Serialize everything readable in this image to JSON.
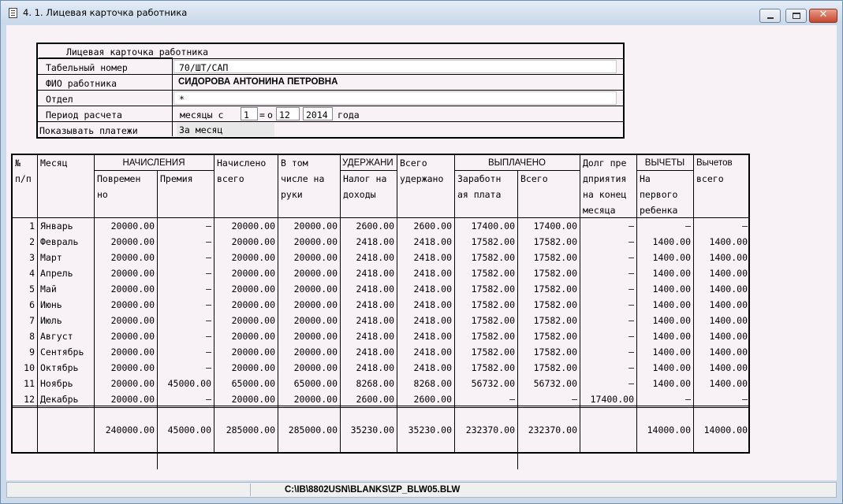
{
  "window": {
    "title": "4. 1. Лицевая карточка работника",
    "close_glyph": "✕"
  },
  "card": {
    "title": "Лицевая карточка работника",
    "rows": [
      {
        "label": "Табельный номер",
        "value": "70/ШТ/САП"
      },
      {
        "label": "ФИО работника",
        "value": "СИДОРОВА АНТОНИНА ПЕТРОВНА"
      },
      {
        "label": "Отдел",
        "value": "*"
      },
      {
        "label": "Период расчета",
        "value": ""
      },
      {
        "label": "Показывать платежи",
        "value": "За месяц"
      }
    ],
    "period": {
      "prefix": "месяцы  с",
      "from": "1",
      "sep": "=",
      "to_label": "о",
      "to": "12",
      "year": "2014",
      "year_suffix": "года"
    }
  },
  "table": {
    "headers": {
      "num": [
        "№",
        "п/п"
      ],
      "month": "Месяц",
      "accruals": "НАЧИСЛЕНИЯ",
      "time_based": [
        "Повремен",
        "но"
      ],
      "bonus": "Премия",
      "accrued_total": [
        "Начислено",
        "всего"
      ],
      "net": [
        "В том",
        "числе на",
        "руки"
      ],
      "deductions": "УДЕРЖАНИ",
      "income_tax": [
        "Налог на",
        "доходы"
      ],
      "total_withheld": [
        "Всего",
        "удержано"
      ],
      "paid": "ВЫПЛАЧЕНО",
      "salary": [
        "Заработн",
        "ая плата"
      ],
      "paid_total": "Всего",
      "debt": [
        "Долг пре",
        "дприятия",
        "на конец",
        "месяца"
      ],
      "exemptions": "ВЫЧЕТЫ",
      "first_child": [
        "На",
        "первого",
        "ребенка"
      ],
      "exemptions_total": [
        "Вычетов",
        "всего"
      ]
    },
    "rows": [
      [
        "1",
        "Январь",
        "20000.00",
        "–",
        "20000.00",
        "20000.00",
        "2600.00",
        "2600.00",
        "17400.00",
        "17400.00",
        "–",
        "–",
        "–"
      ],
      [
        "2",
        "Февраль",
        "20000.00",
        "–",
        "20000.00",
        "20000.00",
        "2418.00",
        "2418.00",
        "17582.00",
        "17582.00",
        "–",
        "1400.00",
        "1400.00"
      ],
      [
        "3",
        "Март",
        "20000.00",
        "–",
        "20000.00",
        "20000.00",
        "2418.00",
        "2418.00",
        "17582.00",
        "17582.00",
        "–",
        "1400.00",
        "1400.00"
      ],
      [
        "4",
        "Апрель",
        "20000.00",
        "–",
        "20000.00",
        "20000.00",
        "2418.00",
        "2418.00",
        "17582.00",
        "17582.00",
        "–",
        "1400.00",
        "1400.00"
      ],
      [
        "5",
        "Май",
        "20000.00",
        "–",
        "20000.00",
        "20000.00",
        "2418.00",
        "2418.00",
        "17582.00",
        "17582.00",
        "–",
        "1400.00",
        "1400.00"
      ],
      [
        "6",
        "Июнь",
        "20000.00",
        "–",
        "20000.00",
        "20000.00",
        "2418.00",
        "2418.00",
        "17582.00",
        "17582.00",
        "–",
        "1400.00",
        "1400.00"
      ],
      [
        "7",
        "Июль",
        "20000.00",
        "–",
        "20000.00",
        "20000.00",
        "2418.00",
        "2418.00",
        "17582.00",
        "17582.00",
        "–",
        "1400.00",
        "1400.00"
      ],
      [
        "8",
        "Август",
        "20000.00",
        "–",
        "20000.00",
        "20000.00",
        "2418.00",
        "2418.00",
        "17582.00",
        "17582.00",
        "–",
        "1400.00",
        "1400.00"
      ],
      [
        "9",
        "Сентябрь",
        "20000.00",
        "–",
        "20000.00",
        "20000.00",
        "2418.00",
        "2418.00",
        "17582.00",
        "17582.00",
        "–",
        "1400.00",
        "1400.00"
      ],
      [
        "10",
        "Октябрь",
        "20000.00",
        "–",
        "20000.00",
        "20000.00",
        "2418.00",
        "2418.00",
        "17582.00",
        "17582.00",
        "–",
        "1400.00",
        "1400.00"
      ],
      [
        "11",
        "Ноябрь",
        "20000.00",
        "45000.00",
        "65000.00",
        "65000.00",
        "8268.00",
        "8268.00",
        "56732.00",
        "56732.00",
        "–",
        "1400.00",
        "1400.00"
      ],
      [
        "12",
        "Декабрь",
        "20000.00",
        "–",
        "20000.00",
        "20000.00",
        "2600.00",
        "2600.00",
        "–",
        "–",
        "17400.00",
        "–",
        "–"
      ]
    ],
    "totals": [
      "",
      "",
      "240000.00",
      "45000.00",
      "285000.00",
      "285000.00",
      "35230.00",
      "35230.00",
      "232370.00",
      "232370.00",
      "",
      "14000.00",
      "14000.00"
    ]
  },
  "status": {
    "path": "C:\\IB\\8802USN\\BLANKS\\ZP_BLW05.BLW"
  }
}
